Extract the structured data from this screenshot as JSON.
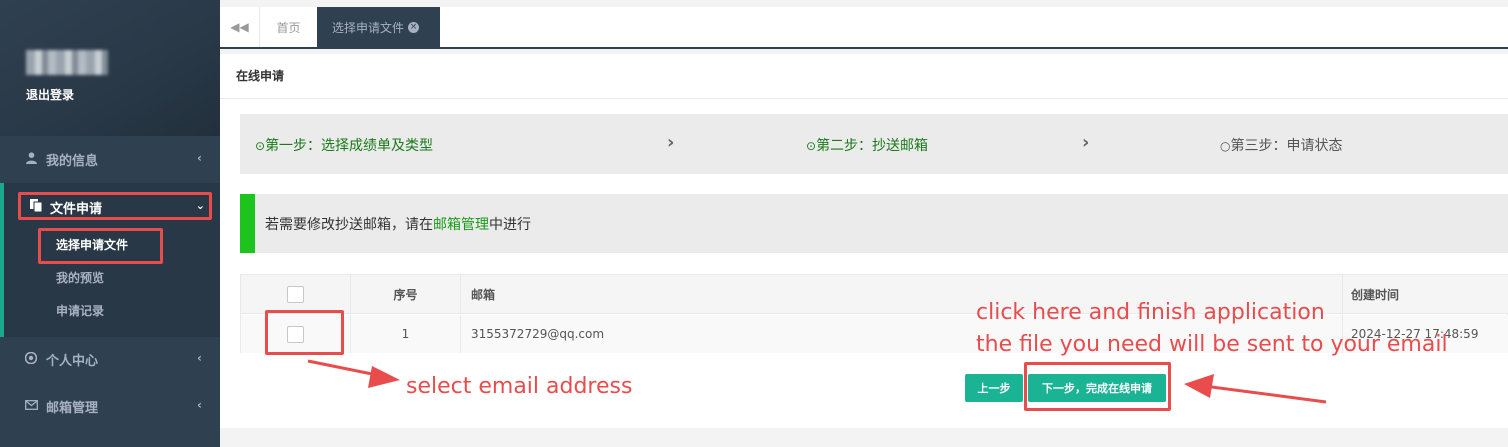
{
  "sidebar": {
    "logout_label": "退出登录",
    "items": [
      {
        "icon": "user-icon",
        "label": "我的信息"
      },
      {
        "icon": "document-icon",
        "label": "文件申请"
      },
      {
        "icon": "chrome-icon",
        "label": "个人中心"
      },
      {
        "icon": "mail-icon",
        "label": "邮箱管理"
      }
    ],
    "subitems": [
      "选择申请文件",
      "我的预览",
      "申请记录"
    ]
  },
  "tabs": {
    "home_label": "首页",
    "active_label": "选择申请文件"
  },
  "panel": {
    "title": "在线申请",
    "steps": [
      {
        "label": "第一步：选择成绩单及类型",
        "state": "done"
      },
      {
        "label": "第二步：抄送邮箱",
        "state": "done"
      },
      {
        "label": "第三步：申请状态",
        "state": "todo"
      }
    ],
    "notice": {
      "before": "若需要修改抄送邮箱，请在",
      "link": "邮箱管理",
      "after": "中进行"
    },
    "table": {
      "headers": [
        "序号",
        "邮箱",
        "创建时间"
      ],
      "rows": [
        {
          "index": "1",
          "email": "3155372729@qq.com",
          "created": "2024-12-27 17:48:59"
        }
      ]
    },
    "buttons": {
      "prev": "上一步",
      "next": "下一步，完成在线申请"
    }
  },
  "annotations": {
    "select_email": "select email address",
    "click_here_line1": "click here and finish application",
    "click_here_line2": "the file you need will be sent to your email"
  },
  "colors": {
    "sidebar_bg": "#2f4050",
    "accent": "#1ab394",
    "annotation_red": "#e84c4c",
    "step_done": "#1a7a1a"
  }
}
